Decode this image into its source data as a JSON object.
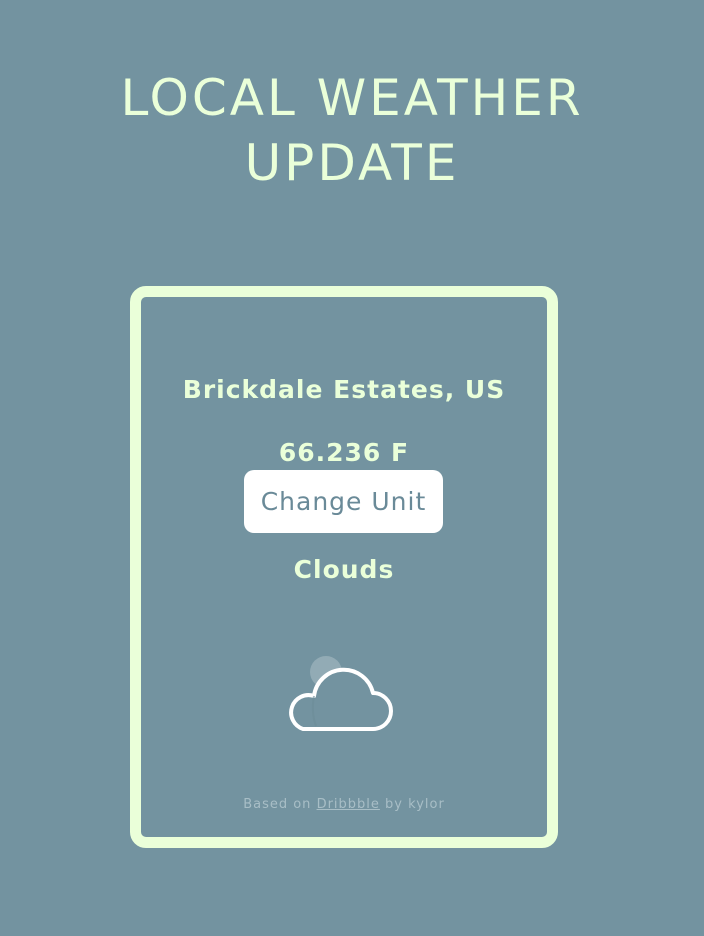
{
  "header": {
    "title_line1": "LOCAL WEATHER",
    "title_line2": "UPDATE"
  },
  "weather": {
    "location": "Brickdale Estates, US",
    "temperature": "66.236 F",
    "change_unit_label": "Change Unit",
    "condition": "Clouds",
    "icon": "cloud-icon"
  },
  "footer": {
    "prefix": "Based on",
    "link_text": "Dribbble",
    "suffix": "by kylor"
  },
  "colors": {
    "background": "#7393a0",
    "accent": "#eaffd9",
    "button_bg": "#ffffff",
    "button_text": "#6a8a98"
  }
}
